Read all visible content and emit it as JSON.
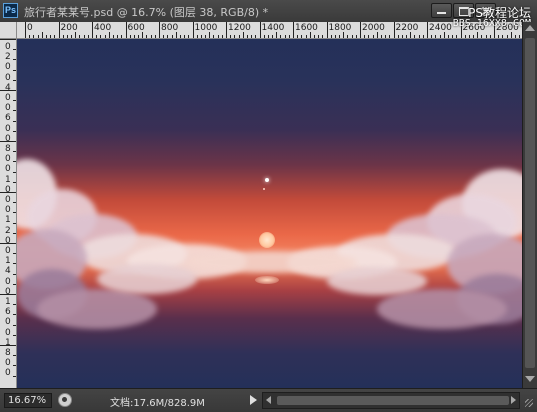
{
  "app": {
    "badge": "Ps",
    "document_title": "旅行者某某号.psd @ 16.7% (图层 38, RGB/8) *"
  },
  "watermark": {
    "line1": "PS教程论坛",
    "line2": "BBS.16XX8.COM"
  },
  "ruler": {
    "top_labels": [
      "0",
      "200",
      "400",
      "600",
      "800",
      "1000",
      "1200",
      "1400",
      "1600",
      "1800",
      "2000",
      "2200",
      "2400",
      "2600",
      "2800"
    ],
    "left_labels": [
      "0",
      "2",
      "0",
      "0",
      "4",
      "0",
      "0",
      "6",
      "0",
      "0",
      "8",
      "0",
      "0",
      "1",
      "0",
      "0",
      "0",
      "1",
      "2",
      "0",
      "0",
      "1",
      "4",
      "0",
      "0",
      "1",
      "6",
      "0",
      "0",
      "1",
      "8",
      "0",
      "0"
    ]
  },
  "status": {
    "zoom": "16.67%",
    "doc_info": "文档:17.6M/828.9M"
  },
  "icons": {
    "app": "photoshop-badge-icon",
    "minimize": "minimize-icon",
    "maximize": "maximize-icon",
    "close": "close-icon",
    "status": "status-menu-icon",
    "arrow": "play-arrow-icon"
  },
  "colors": {
    "sky_top": "#243059",
    "horizon_glow": "#f07a58",
    "chrome_dark": "#2f2f2f"
  }
}
